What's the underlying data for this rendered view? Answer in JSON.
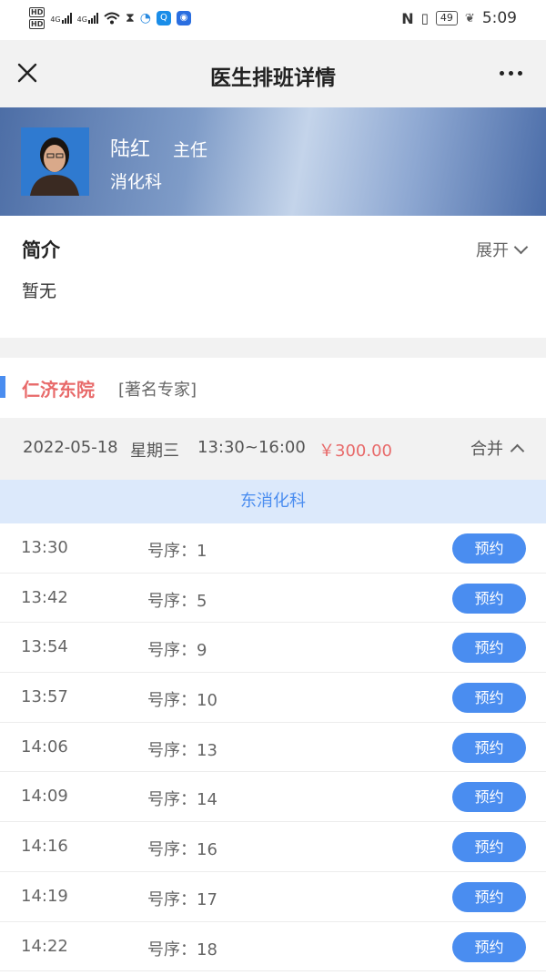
{
  "status_bar": {
    "network_left": "HD",
    "network_left2": "HD",
    "signal1": "4G",
    "signal2": "4G",
    "battery": "49",
    "time": "5:09"
  },
  "nav": {
    "title": "医生排班详情",
    "close_icon": "close-icon",
    "more_icon": "more-icon"
  },
  "doctor": {
    "name": "陆红",
    "title": "主任",
    "department": "消化科"
  },
  "intro": {
    "heading": "简介",
    "expand_label": "展开",
    "text": "暂无"
  },
  "hospital": {
    "name": "仁济东院",
    "tag": "[著名专家]"
  },
  "schedule": {
    "date": "2022-05-18",
    "weekday": "星期三",
    "time_range": "13:30~16:00",
    "price": "￥300.00",
    "collapse_label": "合并",
    "department": "东消化科"
  },
  "slots": [
    {
      "time": "13:30",
      "number": "号序：1",
      "action": "预约"
    },
    {
      "time": "13:42",
      "number": "号序：5",
      "action": "预约"
    },
    {
      "time": "13:54",
      "number": "号序：9",
      "action": "预约"
    },
    {
      "time": "13:57",
      "number": "号序：10",
      "action": "预约"
    },
    {
      "time": "14:06",
      "number": "号序：13",
      "action": "预约"
    },
    {
      "time": "14:09",
      "number": "号序：14",
      "action": "预约"
    },
    {
      "time": "14:16",
      "number": "号序：16",
      "action": "预约"
    },
    {
      "time": "14:19",
      "number": "号序：17",
      "action": "预约"
    },
    {
      "time": "14:22",
      "number": "号序：18",
      "action": "预约"
    }
  ],
  "colors": {
    "accent_blue": "#4a8df0",
    "price_red": "#e86a6a",
    "dept_band": "#dce9fb"
  }
}
